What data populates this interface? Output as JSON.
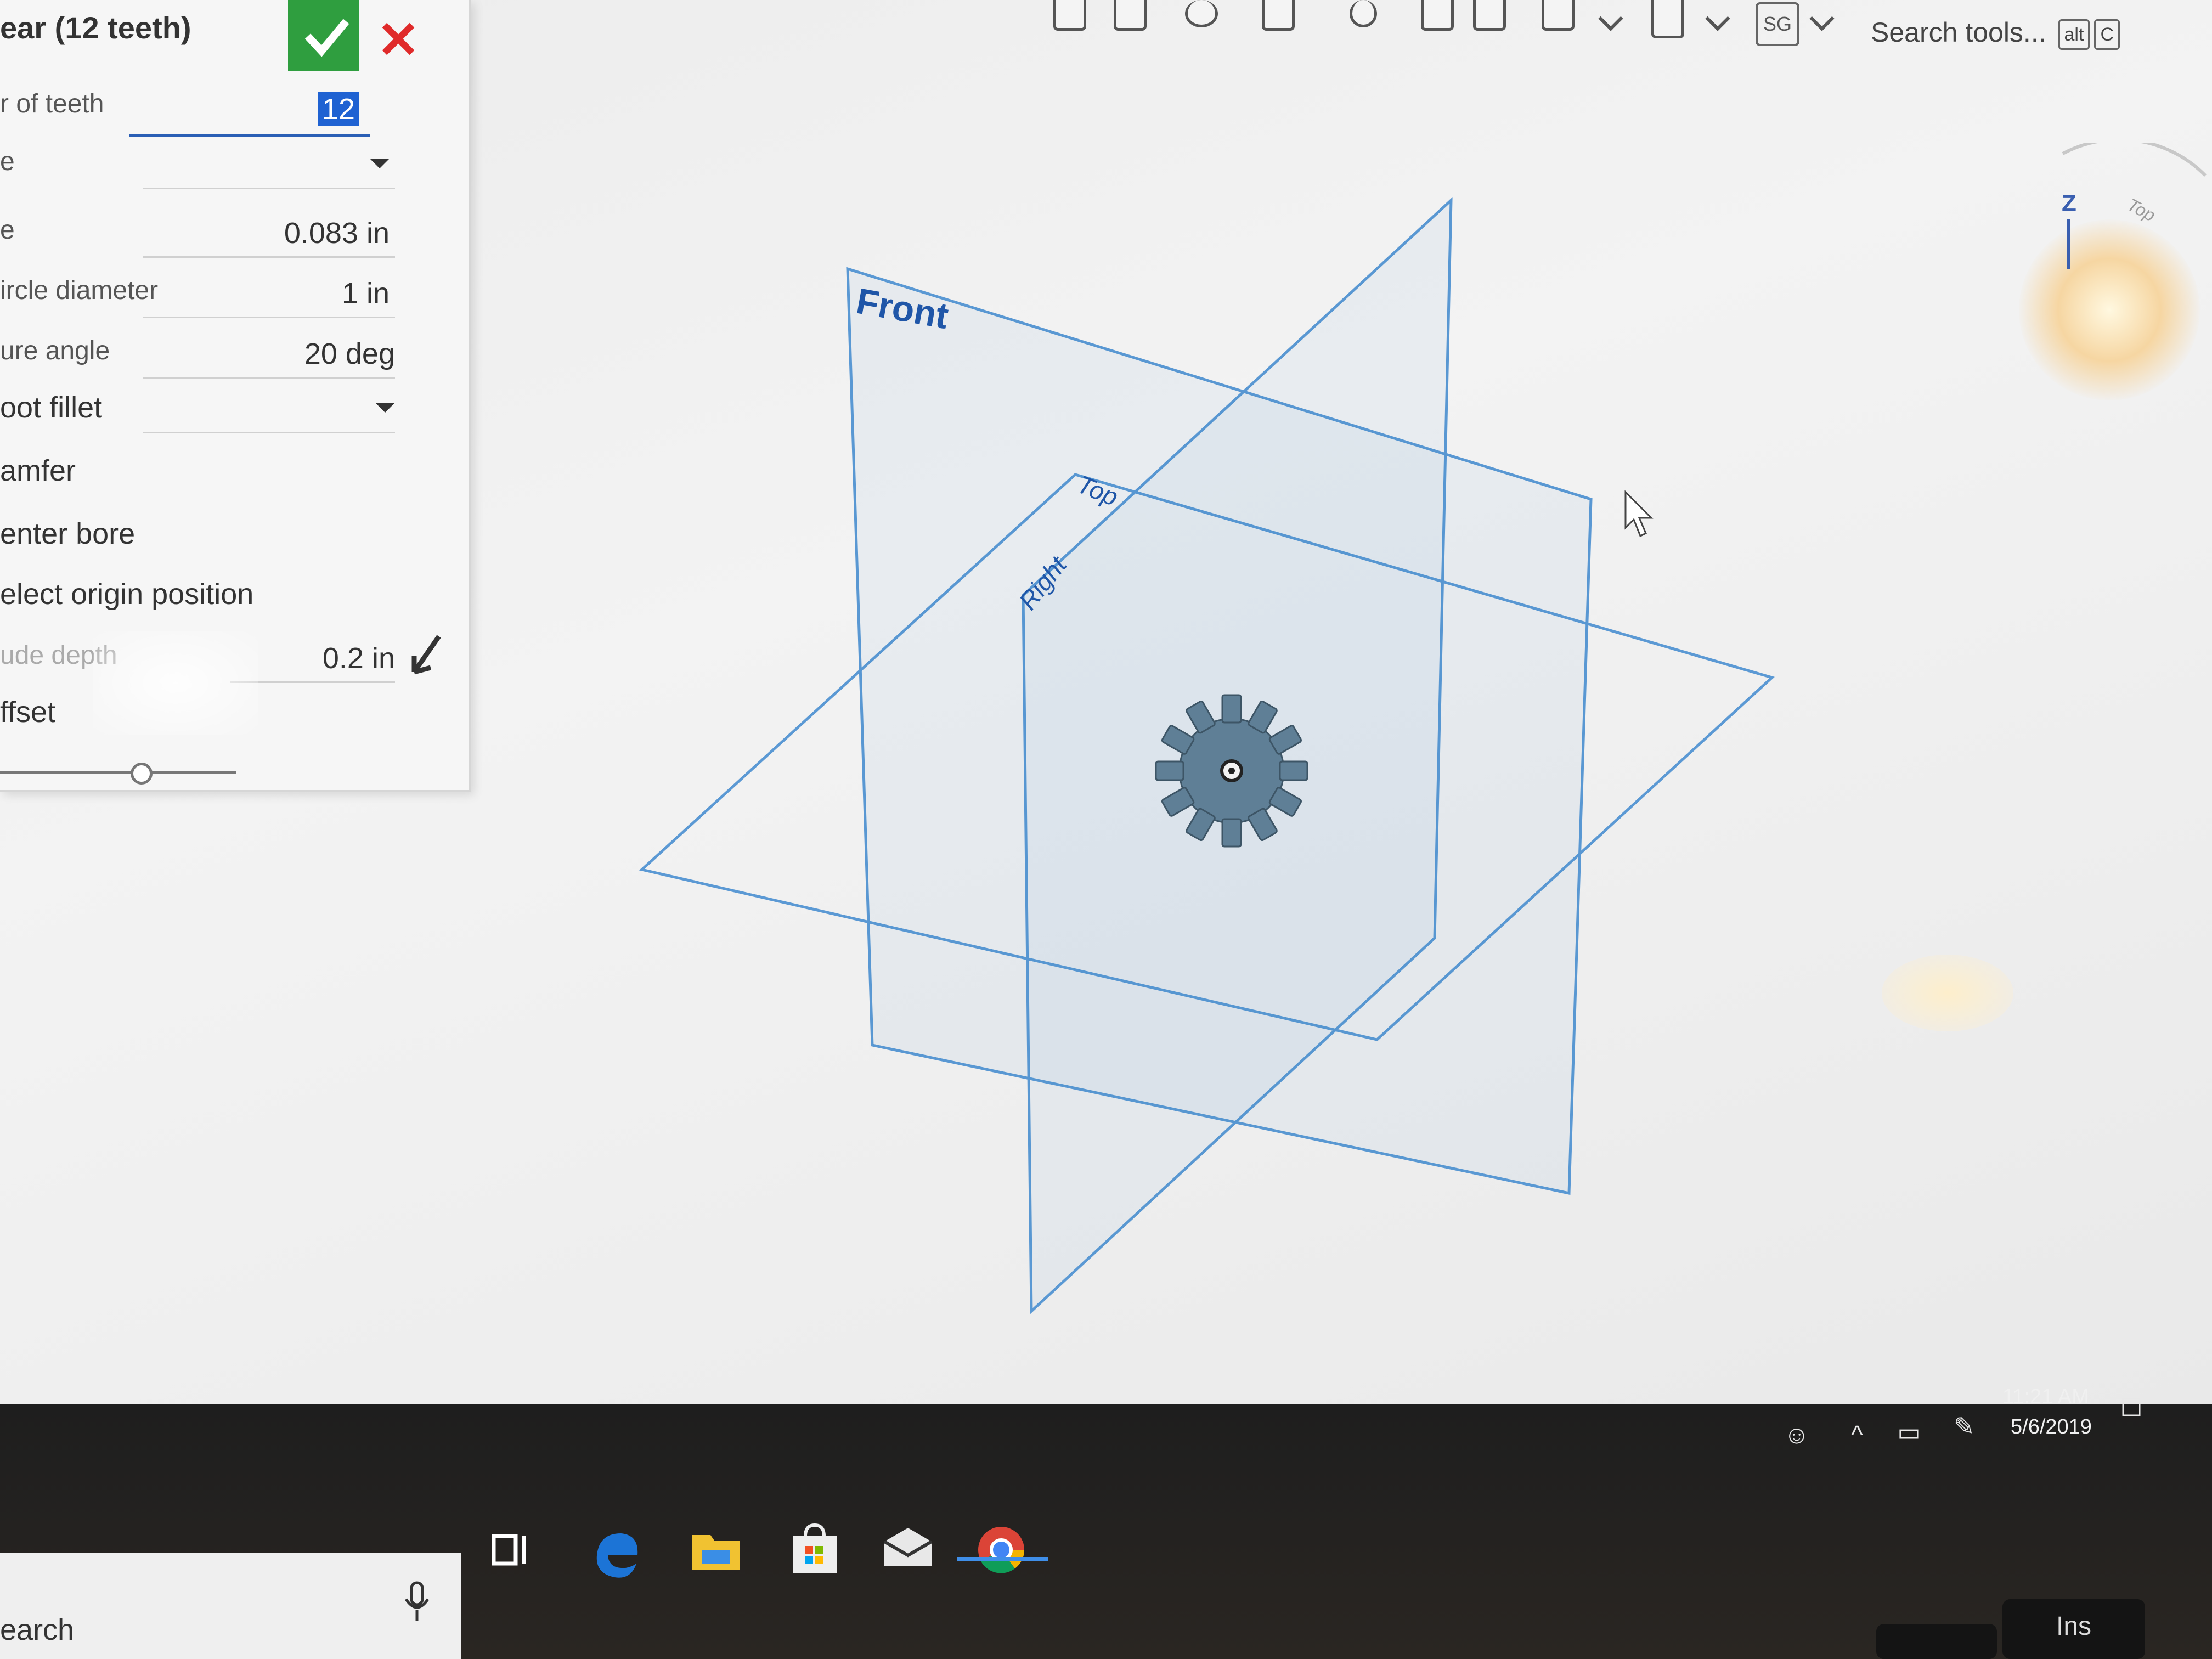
{
  "toolbar": {
    "icons": [
      "sketch-icon",
      "extrude-icon",
      "delete-part-icon",
      "fillet-icon",
      "remove-icon",
      "insert-icon",
      "layers-icon",
      "part-studio-icon",
      "drawing-icon"
    ],
    "user_initials": "SG",
    "search_label": "Search tools...",
    "shortcut_keys": [
      "alt",
      "C"
    ]
  },
  "dialog": {
    "title": "ear (12 teeth)",
    "fields": {
      "teeth_label": "r of teeth",
      "teeth_value": "12",
      "type_label": "e",
      "module_label": "e",
      "module_value": "0.083 in",
      "pitch_label": "ircle diameter",
      "pitch_value": "1 in",
      "pressure_label": "ure angle",
      "pressure_value": "20 deg",
      "root_fillet_label": "oot fillet",
      "chamfer_label": "amfer",
      "center_bore_label": "enter bore",
      "origin_label": "elect origin position",
      "depth_label": "ude depth",
      "depth_value": "0.2 in",
      "offset_label": "ffset"
    },
    "offset_slider_fraction": 0.6
  },
  "viewport": {
    "plane_labels": {
      "front": "Front",
      "top": "Top",
      "right": "Right"
    },
    "plane_color": "#4a8fd0",
    "gear_color": "#5f7f96",
    "view_cube": {
      "axis_label": "Z",
      "face_label": "Top"
    }
  },
  "taskbar": {
    "search_label": "earch",
    "apps": [
      "task-view-icon",
      "edge-icon",
      "file-explorer-icon",
      "store-icon",
      "mail-icon",
      "chrome-icon"
    ],
    "time": "11:21 AM",
    "date": "5/6/2019"
  },
  "keyboard": {
    "key_label": "Ins"
  }
}
